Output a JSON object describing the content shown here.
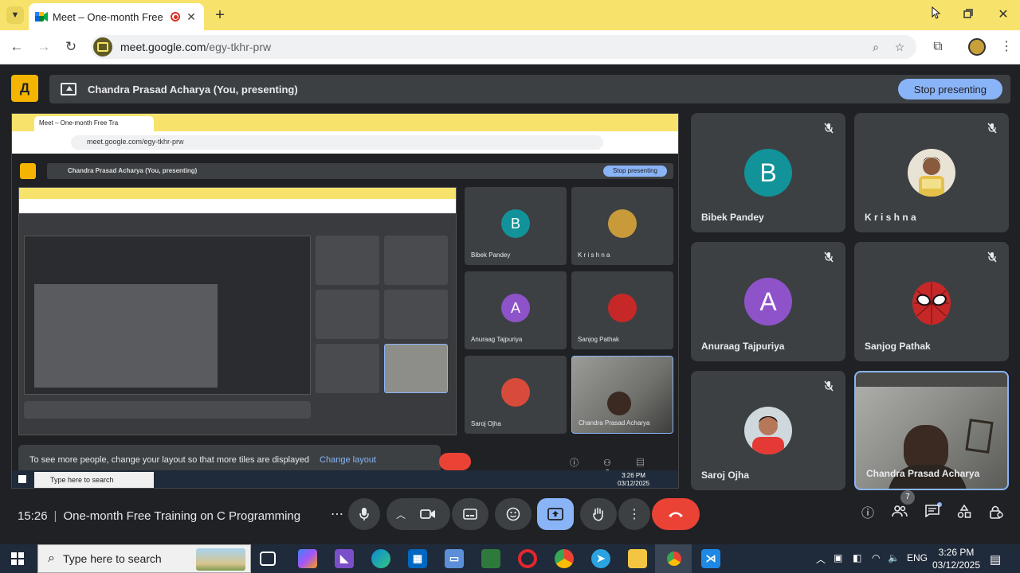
{
  "browser": {
    "tab_title": "Meet – One-month Free Tra",
    "url_host": "meet.google.com",
    "url_path": "/egy-tkhr-prw",
    "new_tab_icon": "plus-icon",
    "colors": {
      "tabstrip": "#f7e36b",
      "accent": "#8ab4f8",
      "hangup": "#ea4335"
    }
  },
  "meet": {
    "presenting_text": "Chandra Prasad Acharya (You, presenting)",
    "stop_presenting": "Stop presenting",
    "clock": "15:26",
    "meeting_title": "One-month Free Training on C Programming",
    "people_badge": "7",
    "participants": [
      {
        "name": "Bibek Pandey",
        "initial": "B",
        "color": "#12939a",
        "muted": true
      },
      {
        "name": "K r i s h n a",
        "initial": "",
        "color": "",
        "muted": true
      },
      {
        "name": "Anuraag Tajpuriya",
        "initial": "A",
        "color": "#8e53c9",
        "muted": true
      },
      {
        "name": "Sanjog Pathak",
        "initial": "",
        "color": "",
        "muted": true
      },
      {
        "name": "Saroj Ojha",
        "initial": "",
        "color": "",
        "muted": true
      },
      {
        "name": "Chandra Prasad Acharya",
        "initial": "",
        "color": "",
        "muted": false
      }
    ]
  },
  "shared_screen": {
    "tab_title": "Meet – One-month Free Tra",
    "url": "meet.google.com/egy-tkhr-prw",
    "presenting_text": "Chandra Prasad Acharya (You, presenting)",
    "stop_presenting": "Stop presenting",
    "toast_text": "To see more people, change your layout so that more tiles are displayed",
    "toast_link": "Change layout",
    "taskbar_search": "Type here to search",
    "time": "3:26 PM",
    "date": "03/12/2025"
  },
  "taskbar": {
    "search_placeholder": "Type here to search",
    "lang": "ENG",
    "time": "3:26 PM",
    "date": "03/12/2025"
  }
}
